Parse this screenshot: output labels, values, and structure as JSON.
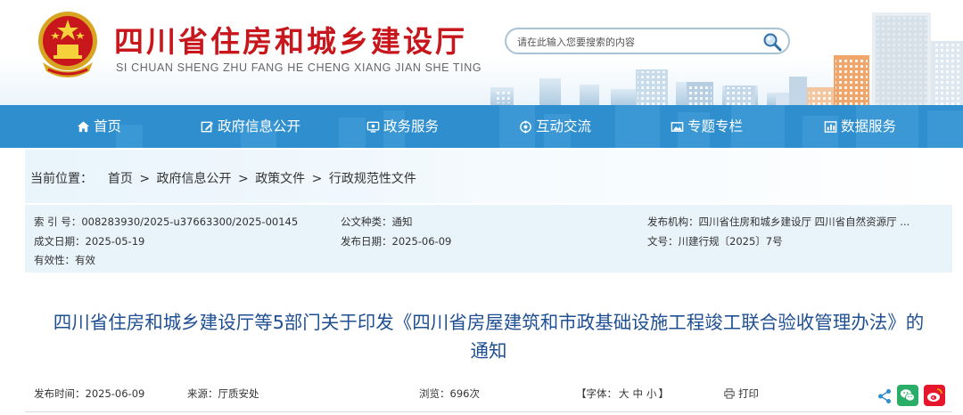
{
  "header": {
    "site_title": "四川省住房和城乡建设厅",
    "site_pinyin": "SI CHUAN SHENG ZHU FANG HE CHENG XIANG JIAN SHE TING",
    "search_placeholder": "请在此输入您要搜索的内容"
  },
  "nav": {
    "items": [
      {
        "label": "首页",
        "icon": "home-icon"
      },
      {
        "label": "政府信息公开",
        "icon": "edit-icon"
      },
      {
        "label": "政务服务",
        "icon": "monitor-icon"
      },
      {
        "label": "互动交流",
        "icon": "interact-icon"
      },
      {
        "label": "专题专栏",
        "icon": "image-icon"
      },
      {
        "label": "数据服务",
        "icon": "chart-icon"
      }
    ]
  },
  "breadcrumb": {
    "prefix": "当前位置：",
    "items": [
      "首页",
      "政府信息公开",
      "政策文件",
      "行政规范性文件"
    ],
    "separator": ">"
  },
  "meta": {
    "index_label": "索 引 号：",
    "index_value": "008283930/2025-u37663300/2025-00145",
    "category_label": "公文种类：",
    "category_value": "通知",
    "issuer_label": "发布机构：",
    "issuer_value": "四川省住房和城乡建设厅 四川省自然资源厅 ...",
    "created_label": "成文日期：",
    "created_value": "2025-05-19",
    "published_label": "发布日期：",
    "published_value": "2025-06-09",
    "docno_label": "文号：",
    "docno_value": "川建行规〔2025〕7号",
    "validity_label": "有效性：",
    "validity_value": "有效"
  },
  "article": {
    "title_line1": "四川省住房和城乡建设厅等5部门关于印发《四川省房屋建筑和市政基础设施工程竣工联合验收管理办法》的",
    "title_line2": "通知",
    "publish_time_label": "发布时间：",
    "publish_time_value": "2025-06-09",
    "source_label": "来源：",
    "source_value": "厅质安处",
    "views_label": "浏览：",
    "views_value": "696次",
    "font_open": "【字体：",
    "font_large": "大",
    "font_medium": "中",
    "font_small": "小",
    "font_close": "】",
    "print_label": "打印"
  },
  "colors": {
    "brand_red": "#c8161d",
    "nav_blue": "#2f8fce",
    "title_blue": "#1f4f93",
    "wechat_green": "#2aae67",
    "weibo_red": "#e6162d",
    "share_blue": "#2f8fce"
  }
}
